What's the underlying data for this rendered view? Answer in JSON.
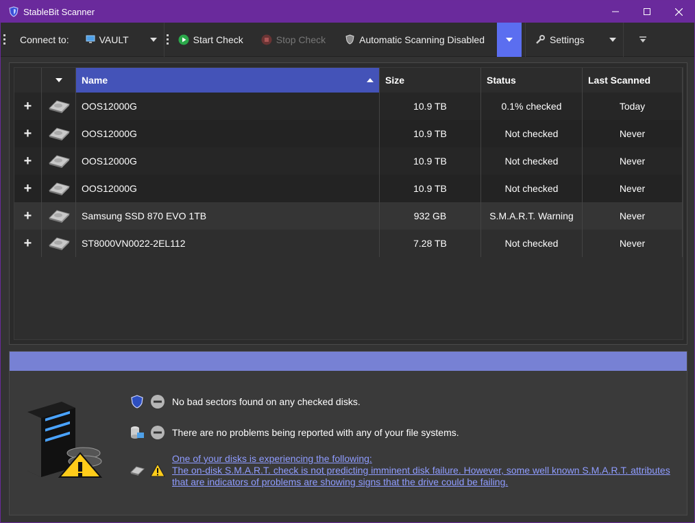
{
  "window": {
    "title": "StableBit Scanner"
  },
  "toolbar": {
    "connect_label": "Connect to:",
    "connect_value": "VAULT",
    "start_check": "Start Check",
    "stop_check": "Stop Check",
    "auto_scan": "Automatic Scanning Disabled",
    "settings": "Settings"
  },
  "grid": {
    "columns": [
      "Name",
      "Size",
      "Status",
      "Last Scanned"
    ],
    "rows": [
      {
        "name": "OOS12000G",
        "size": "10.9 TB",
        "status": "0.1% checked",
        "last": "Today"
      },
      {
        "name": "OOS12000G",
        "size": "10.9 TB",
        "status": "Not checked",
        "last": "Never"
      },
      {
        "name": "OOS12000G",
        "size": "10.9 TB",
        "status": "Not checked",
        "last": "Never"
      },
      {
        "name": "OOS12000G",
        "size": "10.9 TB",
        "status": "Not checked",
        "last": "Never"
      },
      {
        "name": "Samsung SSD 870 EVO 1TB",
        "size": "932 GB",
        "status": "S.M.A.R.T. Warning",
        "last": "Never"
      },
      {
        "name": "ST8000VN0022-2EL112",
        "size": "7.28 TB",
        "status": "Not checked",
        "last": "Never"
      }
    ]
  },
  "status": {
    "msg1": "No bad sectors found on any checked disks.",
    "msg2": "There are no problems being reported with any of your file systems.",
    "msg3_line1": "One of your disks is experiencing the following:",
    "msg3_line2": "The on-disk S.M.A.R.T. check is not predicting imminent disk failure. However, some well known S.M.A.R.T. attributes",
    "msg3_line3": "that are indicators of problems are showing signs that the drive could be failing."
  },
  "colors": {
    "titlebar": "#6a2a9c",
    "accent": "#5b6ef0",
    "header_selected": "#4453b8",
    "status_bar": "#7781d4",
    "link": "#8f9cff"
  }
}
